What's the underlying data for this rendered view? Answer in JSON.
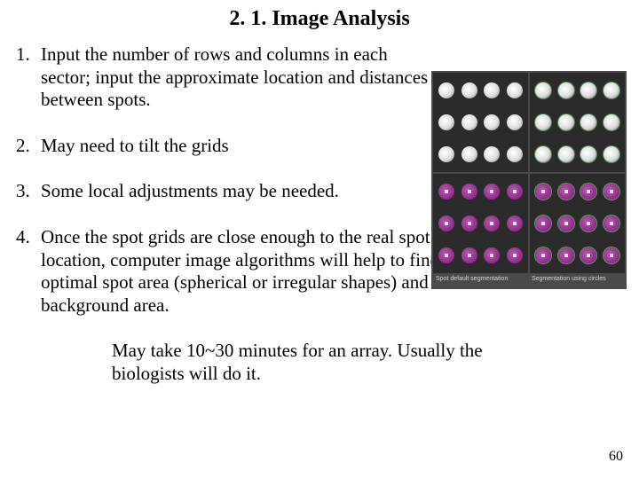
{
  "title": "2. 1. Image Analysis",
  "items": [
    {
      "num": "1.",
      "text": "Input the number of rows and columns in each sector; input the approximate location and distances between spots."
    },
    {
      "num": "2.",
      "text": "May need to tilt the grids"
    },
    {
      "num": "3.",
      "text": "Some local adjustments may be needed."
    },
    {
      "num": "4.",
      "text": "Once the spot grids are close enough to the real spot physical location, computer image algorithms will help to find the optimal spot area (spherical or irregular shapes) and background area."
    }
  ],
  "footnote": "May take 10~30 minutes for an array. Usually the biologists will do it.",
  "page_number": "60",
  "figure": {
    "caption_left": "Spot default segmentation",
    "caption_right": "Segmentation using circles"
  }
}
